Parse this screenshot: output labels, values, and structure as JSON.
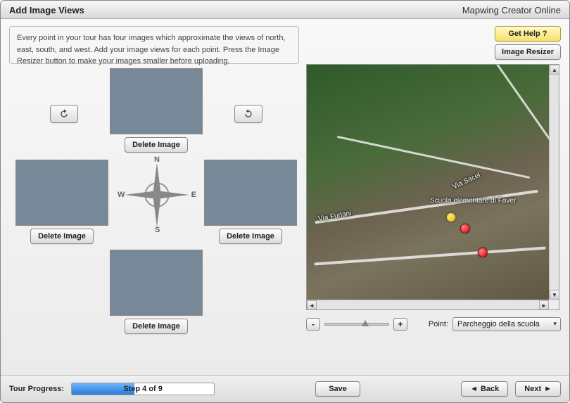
{
  "titlebar": {
    "title": "Add Image Views",
    "app_name": "Mapwing Creator Online"
  },
  "instructions": "Every point in your tour has four images which approximate the views of north, east, south, and west. Add your image views for each point. Press the Image Resizer button to make your images smaller before uploading.",
  "buttons": {
    "help": "Get Help ?",
    "resizer": "Image Resizer",
    "delete_image": "Delete Image",
    "save": "Save",
    "back": "Back",
    "next": "Next"
  },
  "compass": {
    "n": "N",
    "e": "E",
    "s": "S",
    "w": "W"
  },
  "map": {
    "labels": {
      "via_sacel": "Via Sacel",
      "via_furlani": "Via Furlani",
      "scuola": "Scuola elementare di Faver"
    }
  },
  "point": {
    "label": "Point:",
    "selected": "Parcheggio della scuola"
  },
  "zoom": {
    "minus": "-",
    "plus": "+"
  },
  "progress": {
    "label": "Tour Progress:",
    "text": "Step 4 of 9"
  },
  "nav_glyphs": {
    "back": "◄",
    "next": "►"
  }
}
